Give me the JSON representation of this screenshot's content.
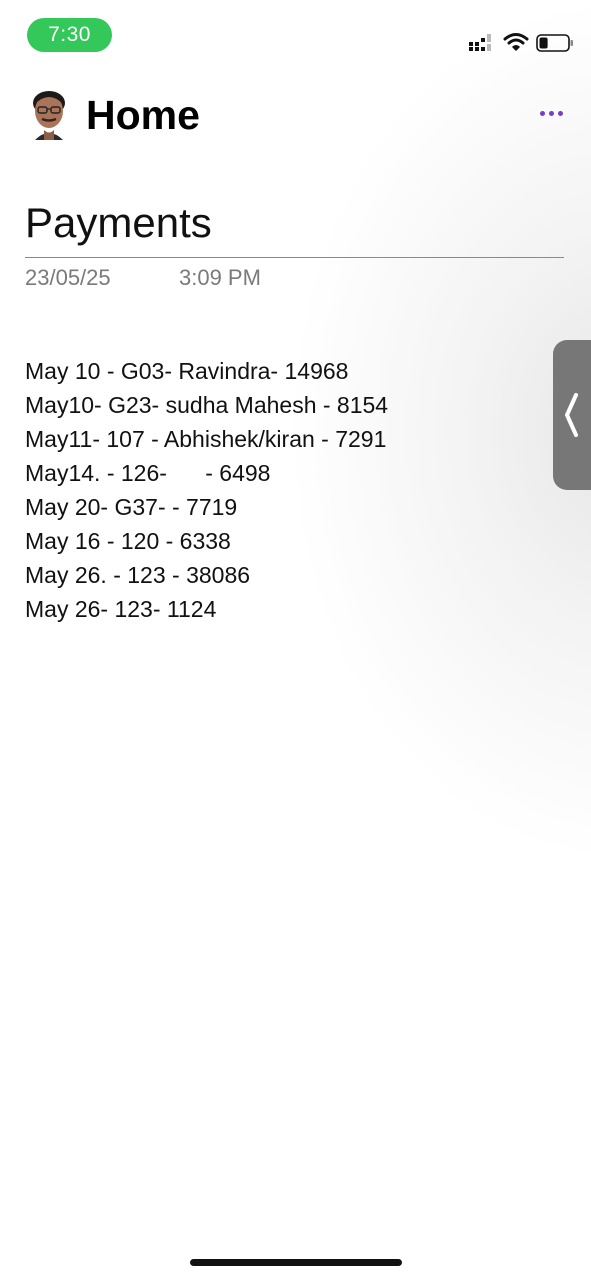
{
  "status_bar": {
    "time": "7:30",
    "signal_icon": "cellular-signal-icon",
    "wifi_icon": "wifi-icon",
    "battery_icon": "battery-icon",
    "battery_level": 0.3
  },
  "header": {
    "title": "Home",
    "avatar_icon": "profile-avatar",
    "more_icon": "more-horizontal-icon",
    "accent_color": "#7a3ec4"
  },
  "note": {
    "title": "Payments",
    "date": "23/05/25",
    "time": "3:09 PM",
    "entries": [
      "May 10 - G03- Ravindra- 14968",
      "May10- G23- sudha Mahesh - 8154",
      "May11- 107 - Abhishek/kiran - 7291",
      "May14. - 126-      - 6498",
      "May 20- G37- - 7719",
      "May 16 - 120 - 6338",
      "May 26. - 123 - 38086",
      "May 26- 123- 1124"
    ]
  },
  "side_handle": {
    "icon": "chevron-left-icon"
  }
}
